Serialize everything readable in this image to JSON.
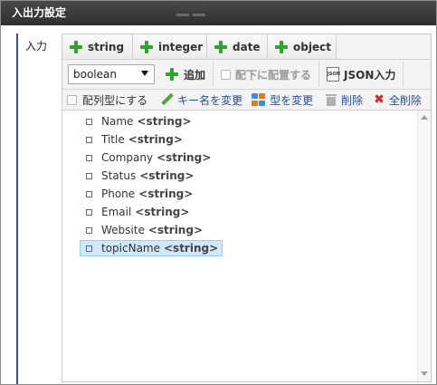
{
  "window": {
    "title": "入出力設定"
  },
  "field": {
    "label": "入力"
  },
  "type_buttons": [
    {
      "label": "string"
    },
    {
      "label": "integer"
    },
    {
      "label": "date"
    },
    {
      "label": "object"
    }
  ],
  "toolbar": {
    "type_select_value": "boolean",
    "add_label": "追加",
    "place_under_label": "配下に配置する",
    "json_input_label": "JSON入力",
    "json_icon_text": "JSON"
  },
  "actions": {
    "array_type_label": "配列型にする",
    "rename_key_label": "キー名を変更",
    "change_type_label": "型を変更",
    "delete_label": "削除",
    "delete_all_label": "全削除"
  },
  "tree": {
    "items": [
      {
        "name": "Name",
        "type": "<string>"
      },
      {
        "name": "Title",
        "type": "<string>"
      },
      {
        "name": "Company",
        "type": "<string>"
      },
      {
        "name": "Status",
        "type": "<string>"
      },
      {
        "name": "Phone",
        "type": "<string>"
      },
      {
        "name": "Email",
        "type": "<string>"
      },
      {
        "name": "Website",
        "type": "<string>"
      },
      {
        "name": "topicName",
        "type": "<string>"
      }
    ],
    "selected_index": 7
  },
  "colors": {
    "titlebar": "#2e2e2e",
    "accent_line": "#3a4f9a",
    "plus_green": "#2ea32e",
    "link_blue": "#224ea0",
    "delete_red": "#d7261e",
    "selection": "#cfe8fb"
  }
}
